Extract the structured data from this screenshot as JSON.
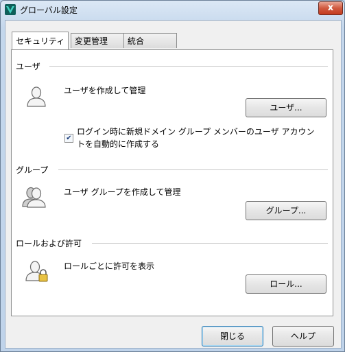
{
  "window": {
    "title": "グローバル設定",
    "close_glyph": "x"
  },
  "tabs": [
    {
      "label": "セキュリティ",
      "active": true
    },
    {
      "label": "変更管理",
      "active": false
    },
    {
      "label": "統合",
      "active": false
    }
  ],
  "sections": {
    "users": {
      "title": "ユーザ",
      "description": "ユーザを作成して管理",
      "button": "ユーザ...",
      "icon": "user-icon",
      "checkbox": {
        "checked": true,
        "label_line1": "ログイン時に新規ドメイン グループ メンバーのユーザ アカウン",
        "label_line2": "トを自動的に作成する"
      }
    },
    "groups": {
      "title": "グループ",
      "description": "ユーザ グループを作成して管理",
      "button": "グループ...",
      "icon": "user-group-icon"
    },
    "roles": {
      "title": "ロールおよび許可",
      "description": "ロールごとに許可を表示",
      "button": "ロール...",
      "icon": "user-lock-icon"
    }
  },
  "footer": {
    "close_button": "閉じる",
    "help_button": "ヘルプ"
  },
  "colors": {
    "title_bar": "#c4d7ec",
    "close_button": "#c43c1f",
    "panel_background": "#ffffff",
    "dialog_background": "#f0f0f0"
  }
}
